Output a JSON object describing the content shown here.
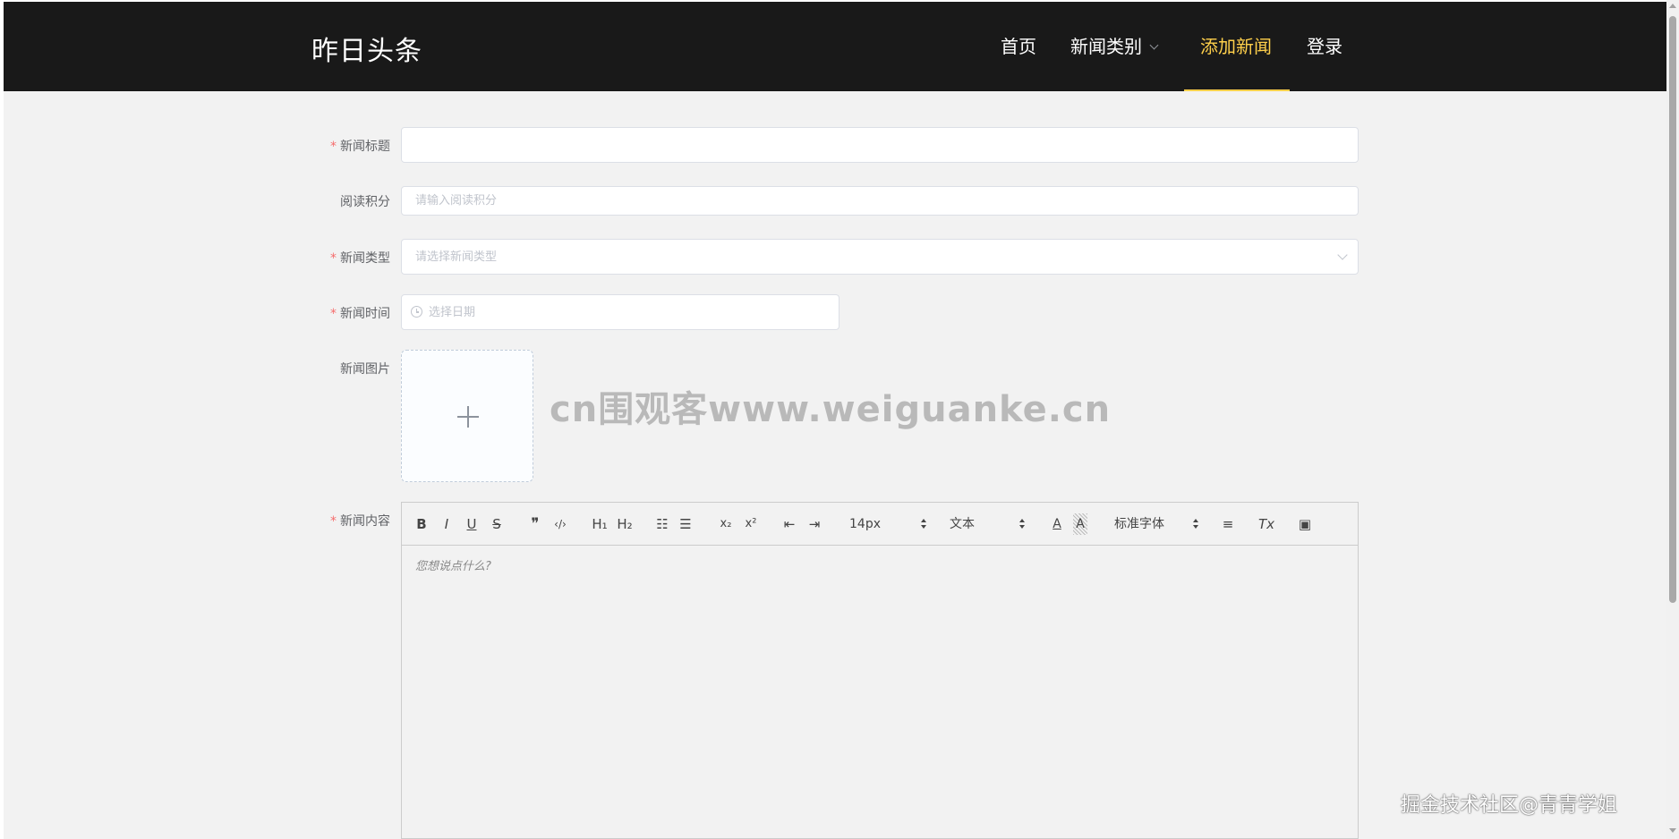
{
  "header": {
    "brand": "昨日头条",
    "nav": [
      {
        "label": "首页"
      },
      {
        "label": "新闻类别"
      },
      {
        "label": "添加新闻"
      },
      {
        "label": "登录"
      }
    ],
    "active_color": "#ffd04b",
    "background": "#191919"
  },
  "form": {
    "title_label": "新闻标题",
    "title_value": "",
    "points_label": "阅读积分",
    "points_placeholder": "请输入阅读积分",
    "type_label": "新闻类型",
    "type_placeholder": "请选择新闻类型",
    "time_label": "新闻时间",
    "time_placeholder": "选择日期",
    "image_label": "新闻图片",
    "content_label": "新闻内容",
    "required_mark": "*"
  },
  "editor": {
    "toolbar": {
      "bold": "B",
      "italic": "I",
      "underline": "U",
      "strike": "S",
      "quote": "❞",
      "code": "‹/›",
      "h1": "H₁",
      "h2": "H₂",
      "ordered_list": "☷",
      "bullet_list": "☰",
      "subscript": "x₂",
      "superscript": "x²",
      "outdent": "⇤",
      "indent": "⇥",
      "size": "14px",
      "header_picker": "文本",
      "font_picker": "标准字体",
      "font_color": "A",
      "background_color": "A",
      "align": "≡",
      "clean": "Tx",
      "image": "▣"
    },
    "placeholder": "您想说点什么?"
  },
  "watermark": "cn围观客www.weiguanke.cn",
  "corner_mark": "掘金技术社区@青青学姐"
}
